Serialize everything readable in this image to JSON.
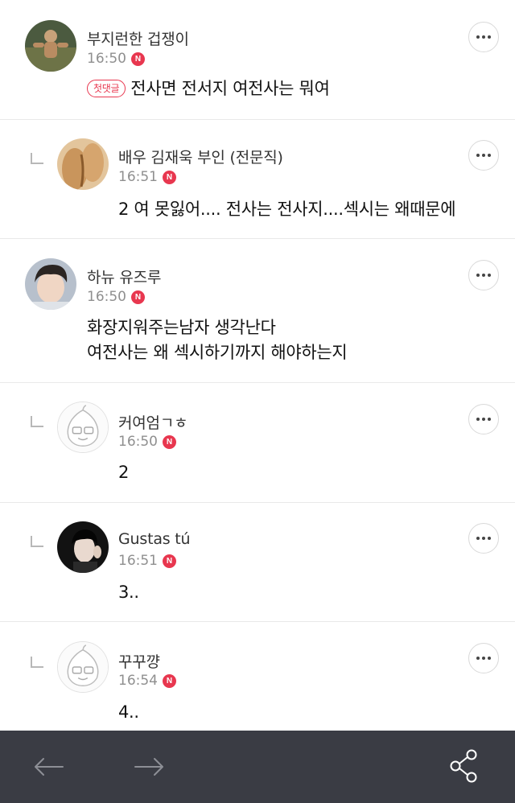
{
  "comments": [
    {
      "name": "부지런한 겁쟁이",
      "time": "16:50",
      "badge": "N",
      "first_tag": "첫댓글",
      "lines": [
        "전사면 전서지 여전사는 뭐여"
      ]
    },
    {
      "name": "배우 김재욱 부인 (전문직)",
      "time": "16:51",
      "badge": "N",
      "lines": [
        "2 여 못잃어.... 전사는 전사지....섹시는 왜때문에"
      ]
    },
    {
      "name": "하뉴 유즈루",
      "time": "16:50",
      "badge": "N",
      "lines": [
        "화장지워주는남자 생각난다",
        "여전사는 왜 섹시하기까지 해야하는지"
      ]
    },
    {
      "name": "커여엄ㄱㅎ",
      "time": "16:50",
      "badge": "N",
      "lines": [
        "2"
      ]
    },
    {
      "name": "Gustas tú",
      "time": "16:51",
      "badge": "N",
      "lines": [
        "3.."
      ]
    },
    {
      "name": "꾸꾸꺙",
      "time": "16:54",
      "badge": "N",
      "lines": [
        "4.."
      ]
    }
  ],
  "colors": {
    "badge": "#e8374f",
    "bottom_bar": "#3a3c44",
    "divider": "#e9e9e9"
  },
  "icons": {
    "more": "more-dots-icon",
    "reply": "reply-indent-icon",
    "back": "arrow-left-icon",
    "forward": "arrow-right-icon",
    "share": "share-icon"
  }
}
